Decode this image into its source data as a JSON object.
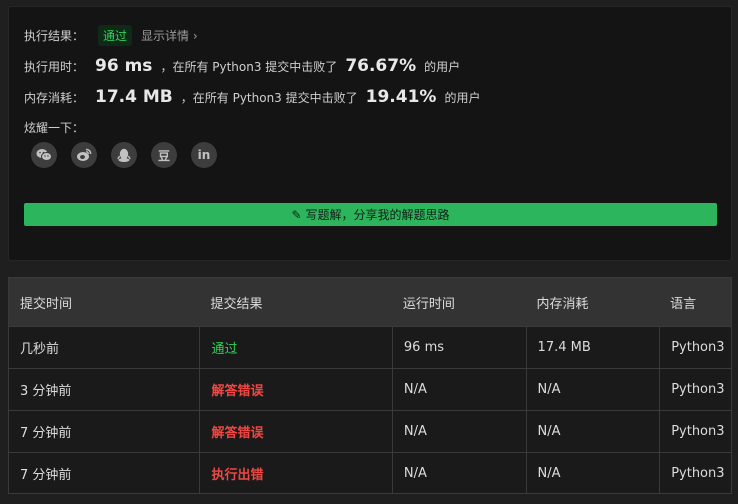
{
  "result": {
    "label": "执行结果：",
    "status": "通过",
    "detail_link": "显示详情 ›"
  },
  "runtime": {
    "label": "执行用时：",
    "value": "96 ms",
    "mid_text": "，在所有 Python3 提交中击败了",
    "percent": "76.67%",
    "suffix": "的用户"
  },
  "memory": {
    "label": "内存消耗：",
    "value": "17.4 MB",
    "mid_text": "，在所有 Python3 提交中击败了",
    "percent": "19.41%",
    "suffix": "的用户"
  },
  "share": {
    "label": "炫耀一下：",
    "icons": [
      "wechat-icon",
      "weibo-icon",
      "qq-icon",
      "douban-icon",
      "linkedin-icon"
    ],
    "douban_glyph": "豆",
    "linkedin_glyph": "in"
  },
  "write_button": {
    "label": "写题解，分享我的解题思路"
  },
  "table": {
    "headers": [
      "提交时间",
      "提交结果",
      "运行时间",
      "内存消耗",
      "语言"
    ],
    "rows": [
      [
        "几秒前",
        "通过",
        "96 ms",
        "17.4 MB",
        "Python3"
      ],
      [
        "3 分钟前",
        "解答错误",
        "N/A",
        "N/A",
        "Python3"
      ],
      [
        "7 分钟前",
        "解答错误",
        "N/A",
        "N/A",
        "Python3"
      ],
      [
        "7 分钟前",
        "执行出错",
        "N/A",
        "N/A",
        "Python3"
      ]
    ]
  },
  "colors": {
    "accepted": "#2fd05a",
    "error": "#ef4743",
    "button": "#2db55d"
  }
}
